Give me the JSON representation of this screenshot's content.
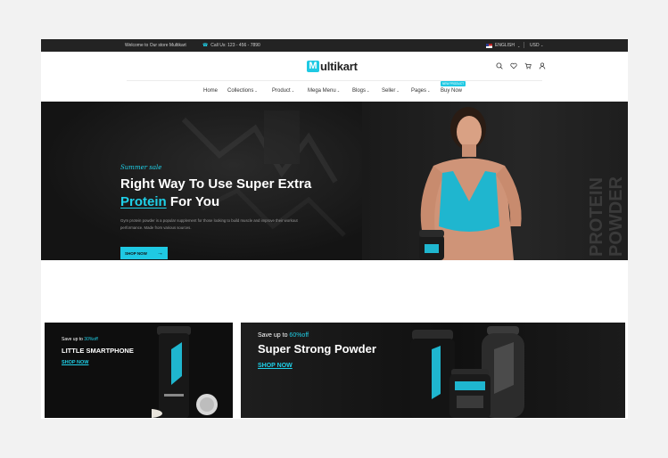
{
  "topbar": {
    "welcome": "Welcome to Our store Multikart",
    "phone": "Call Us: 123 - 456 - 7890",
    "language": "ENGLISH",
    "currency": "USD"
  },
  "logo": {
    "initial": "M",
    "rest": "ultikart"
  },
  "nav": {
    "items": [
      {
        "label": "Home",
        "dropdown": false
      },
      {
        "label": "Collections",
        "dropdown": true
      },
      {
        "label": "Product",
        "dropdown": true
      },
      {
        "label": "Mega Menu",
        "dropdown": true
      },
      {
        "label": "Blogs",
        "dropdown": true
      },
      {
        "label": "Seller",
        "dropdown": true
      },
      {
        "label": "Pages",
        "dropdown": true
      },
      {
        "label": "Buy Now",
        "dropdown": false
      }
    ],
    "badge": "NEW PRODUCT"
  },
  "hero": {
    "eyebrow": "Summer sale",
    "title_line1": "Right Way To Use Super Extra",
    "title_highlight": "Protein",
    "title_rest": " For You",
    "description": "Gym protein powder is a popular supplement for those looking to build muscle and improve their workout performance. Made from various sources.",
    "button": "SHOP NOW",
    "side_text": "PROTEIN POWDER"
  },
  "banner_small": {
    "pre": "Save up to ",
    "percent": "30%off",
    "title": "LITTLE SMARTPHONE",
    "link": "SHOP NOW"
  },
  "banner_large": {
    "pre": "Save up to ",
    "percent": "60%off",
    "title": "Super Strong Powder",
    "link": "SHOP NOW"
  },
  "colors": {
    "accent": "#1fc9e3",
    "dark": "#111111"
  },
  "icons": [
    "search-icon",
    "heart-icon",
    "cart-icon",
    "user-icon"
  ]
}
